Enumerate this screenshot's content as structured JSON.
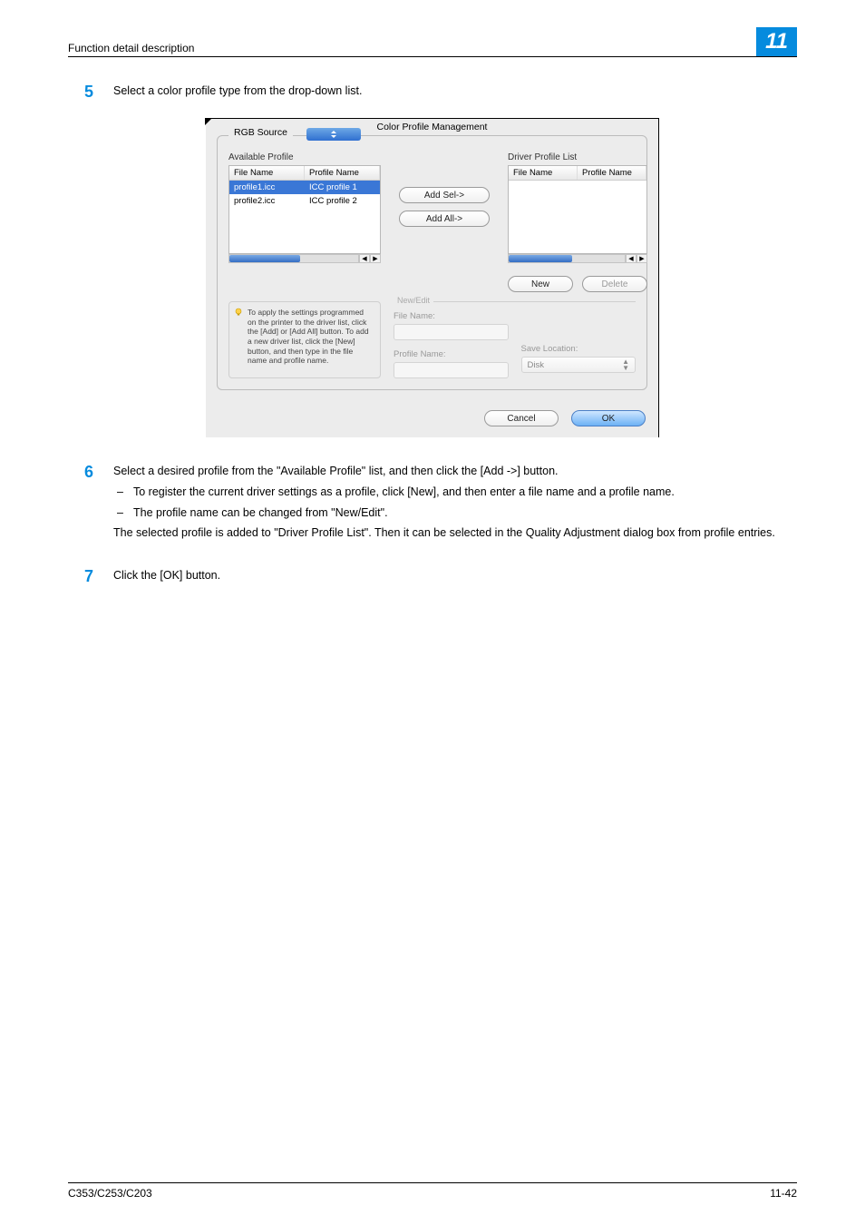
{
  "header": {
    "section_title": "Function detail description",
    "chapter": "11"
  },
  "steps": {
    "s5": {
      "num": "5",
      "text": "Select a color profile type from the drop-down list."
    },
    "s6": {
      "num": "6",
      "text": "Select a desired profile from the \"Available Profile\" list, and then click the [Add ->] button.",
      "sub1": "To register the current driver settings as a profile, click [New], and then enter a file name and a profile name.",
      "sub2": "The profile name can be changed from \"New/Edit\".",
      "para": "The selected profile is added to \"Driver Profile List\". Then it can be selected in the Quality Adjustment dialog box from profile entries."
    },
    "s7": {
      "num": "7",
      "text": "Click the [OK] button."
    }
  },
  "dialog": {
    "title": "Color Profile Management",
    "tab_source": "RGB Source",
    "available_label": "Available Profile",
    "driver_label": "Driver Profile List",
    "col_file": "File Name",
    "col_profile": "Profile Name",
    "rows": {
      "r1_file": "profile1.icc",
      "r1_prof": "ICC profile 1",
      "r2_file": "profile2.icc",
      "r2_prof": "ICC profile 2"
    },
    "btn_add_sel": "Add Sel->",
    "btn_add_all": "Add All->",
    "btn_new": "New",
    "btn_delete": "Delete",
    "tip": "To apply the settings programmed on the printer to the driver list, click the [Add] or [Add All] button. To add a new driver list, click the [New] button, and then type in the file name and profile name.",
    "newedit": "New/Edit",
    "lbl_file_name": "File Name:",
    "lbl_profile_name": "Profile Name:",
    "lbl_save_location": "Save Location:",
    "save_location_value": "Disk",
    "btn_cancel": "Cancel",
    "btn_ok": "OK"
  },
  "footer": {
    "model": "C353/C253/C203",
    "page": "11-42"
  }
}
